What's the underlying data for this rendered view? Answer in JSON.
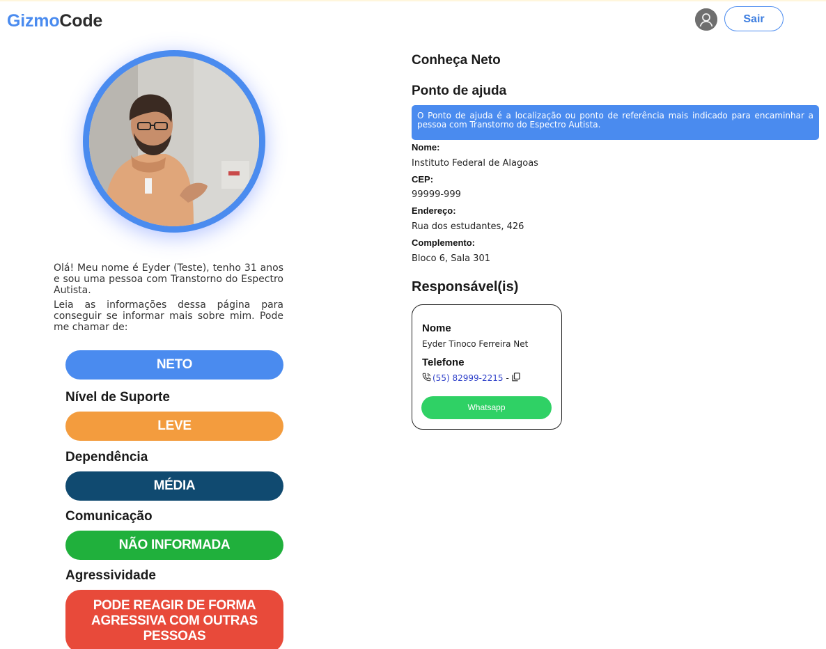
{
  "header": {
    "logo_part1": "Gizmo",
    "logo_part2": "Code",
    "logout_label": "Sair",
    "avatar_icon": "user-icon"
  },
  "profile": {
    "intro_p1": "Olá! Meu nome é Eyder (Teste), tenho 31 anos e sou uma pessoa com Transtorno do Espectro Autista.",
    "intro_p2": "Leia as informações dessa página para conseguir se informar mais sobre mim. Pode me chamar de:",
    "nickname": "NETO",
    "support_label": "Nível de Suporte",
    "support_value": "LEVE",
    "dependency_label": "Dependência",
    "dependency_value": "MÉDIA",
    "communication_label": "Comunicação",
    "communication_value": "NÃO INFORMADA",
    "aggressiveness_label": "Agressividade",
    "aggressiveness_value": "PODE REAGIR DE FORMA AGRESSIVA COM OUTRAS PESSOAS"
  },
  "details": {
    "title": "Conheça Neto",
    "help_point_title": "Ponto de ajuda",
    "help_point_info": "O Ponto de ajuda é a localização ou ponto de referência mais indicado para encaminhar a pessoa com Transtorno do Espectro Autista.",
    "fields": [
      {
        "label": "Nome:",
        "value": "Instituto Federal de Alagoas"
      },
      {
        "label": "CEP:",
        "value": "99999-999"
      },
      {
        "label": "Endereço:",
        "value": "Rua dos estudantes, 426"
      },
      {
        "label": "Complemento:",
        "value": "Bloco 6, Sala 301"
      }
    ],
    "responsible_title": "Responsável(is)"
  },
  "responsible_card": {
    "name_label": "Nome",
    "name_value": "Eyder Tinoco Ferreira Net",
    "phone_label": "Telefone",
    "phone_value": "(55) 82999-2215",
    "phone_separator": "-",
    "phone_icon": "phone-icon",
    "copy_icon": "copy-icon",
    "whatsapp_label": "Whatsapp"
  },
  "colors": {
    "brand_blue": "#4a8bef",
    "support_orange": "#f39c3e",
    "dependency_navy": "#104a70",
    "communication_green": "#20b03c",
    "aggressiveness_red": "#e84a3a",
    "whatsapp_green": "#2fd165"
  }
}
